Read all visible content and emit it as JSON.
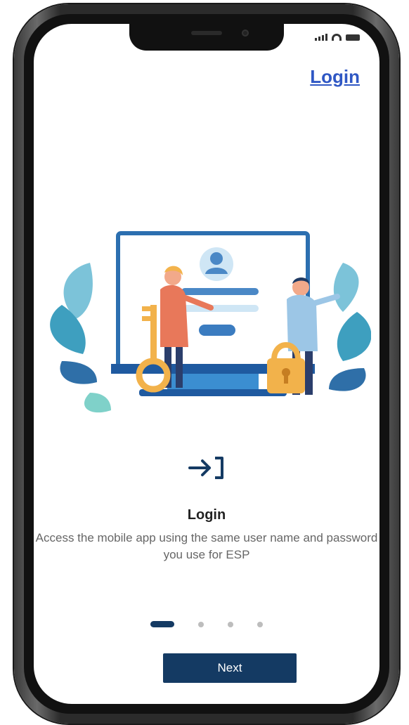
{
  "header": {
    "login_link": "Login"
  },
  "onboarding": {
    "title": "Login",
    "description": "Access the mobile app using the same user name and password you use for ESP",
    "current_step": 1,
    "total_steps": 4,
    "next_label": "Next",
    "icon": "login-arrow-icon"
  },
  "colors": {
    "primary": "#143a63",
    "link": "#2f57c4",
    "dot_inactive": "#bdbdbd",
    "text": "#222222",
    "muted_text": "#666666"
  }
}
